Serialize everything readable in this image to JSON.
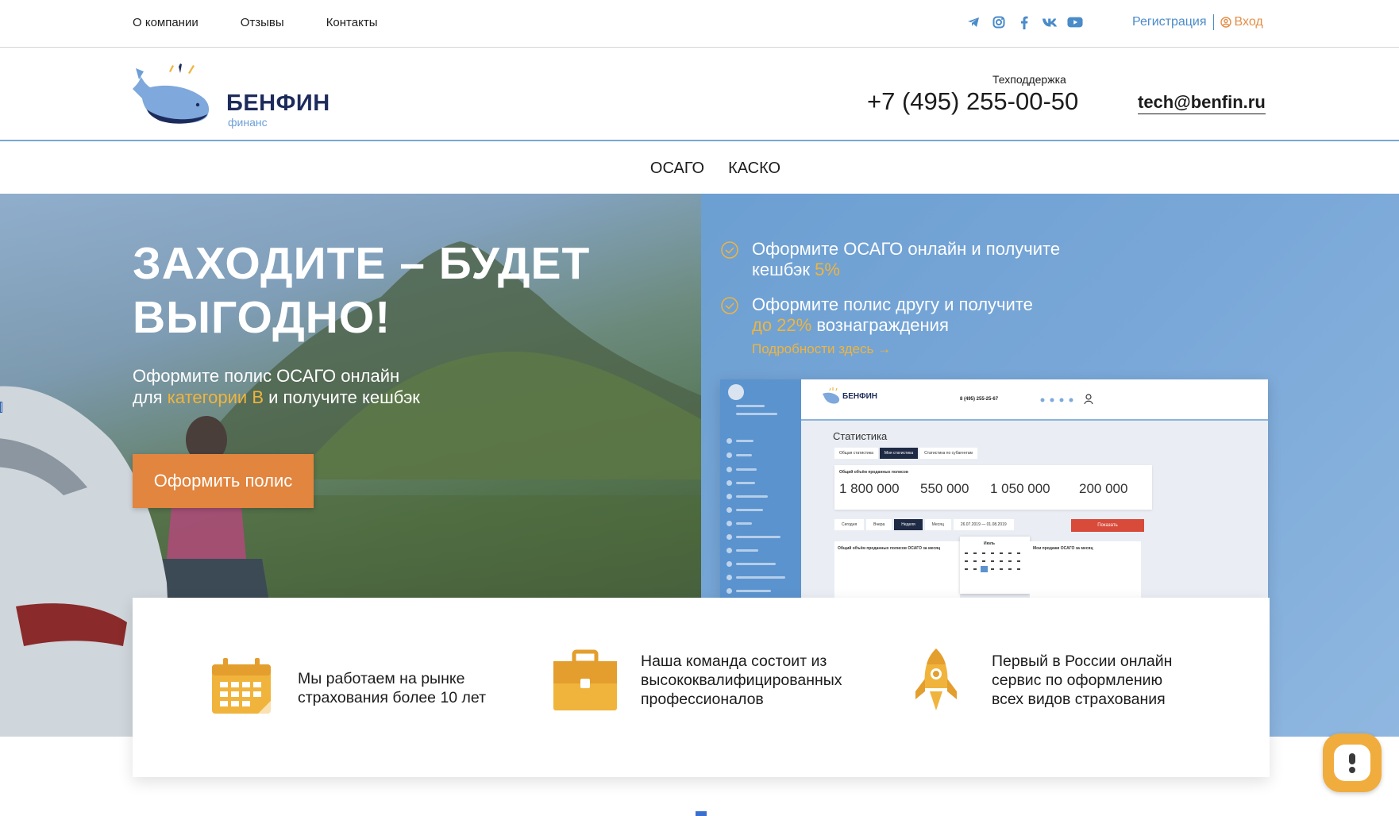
{
  "topbar": {
    "nav": [
      "О компании",
      "Отзывы",
      "Контакты"
    ],
    "socials": [
      "telegram-icon",
      "instagram-icon",
      "facebook-icon",
      "vk-icon",
      "youtube-icon"
    ],
    "register": "Регистрация",
    "login": "Вход"
  },
  "header": {
    "brand": "БЕНФИН",
    "brand_sub": "финанс",
    "support_label": "Техподдержка",
    "phone": "+7 (495) 255-00-50",
    "email": "tech@benfin.ru"
  },
  "mainnav": [
    "ОСАГО",
    "КАСКО"
  ],
  "hero": {
    "title_line1": "ЗАХОДИТЕ – БУДЕТ",
    "title_line2": "ВЫГОДНО!",
    "sub_part1": "Оформите полис ОСАГО онлайн",
    "sub_part2": "для ",
    "sub_highlight": "категории В",
    "sub_part3": " и получите кешбэк",
    "cta": "Оформить полис"
  },
  "perks": [
    {
      "text1": "Оформите ОСАГО онлайн и получите",
      "text2": "кешбэк ",
      "highlight": "5%",
      "text3": ""
    },
    {
      "text1": "Оформите полис другу и получите",
      "text2": "",
      "highlight": "до 22%",
      "text3": " вознаграждения"
    }
  ],
  "details_link": "Подробности здесь →",
  "mockup": {
    "brand": "БЕНФИН",
    "phone": "8 (495) 255-25-67",
    "title": "Статистика",
    "tabs": [
      "Общая статистика",
      "Моя статистика",
      "Статистика по субагентам"
    ],
    "card_label": "Общий объём проданных полисов",
    "stats": [
      "1 800 000",
      "550 000",
      "1 050 000",
      "200 000"
    ],
    "filters": [
      "Сегодня",
      "Вчера",
      "Неделя",
      "Месяц",
      "26.07.2019 — 01.08.2019"
    ],
    "show_button": "Показать",
    "mini_left": "Общий объём проданных полисов ОСАГО за месяц",
    "mini_right": "Мои продажи ОСАГО за месяц",
    "calendar_month": "Июль"
  },
  "features": [
    {
      "icon": "calendar-icon",
      "line1": "Мы работаем на рынке",
      "line2": "страхования более 10 лет",
      "line3": ""
    },
    {
      "icon": "briefcase-icon",
      "line1": "Наша команда состоит из",
      "line2": "высококвалифицированных",
      "line3": "профессионалов"
    },
    {
      "icon": "rocket-icon",
      "line1": "Первый в России онлайн",
      "line2": "сервис по оформлению",
      "line3": "всех видов страхования"
    }
  ],
  "colors": {
    "accent_orange": "#e2853e",
    "highlight_yellow": "#f0b43c",
    "link_blue": "#4a8bc9",
    "brand_navy": "#1d2b5c"
  }
}
